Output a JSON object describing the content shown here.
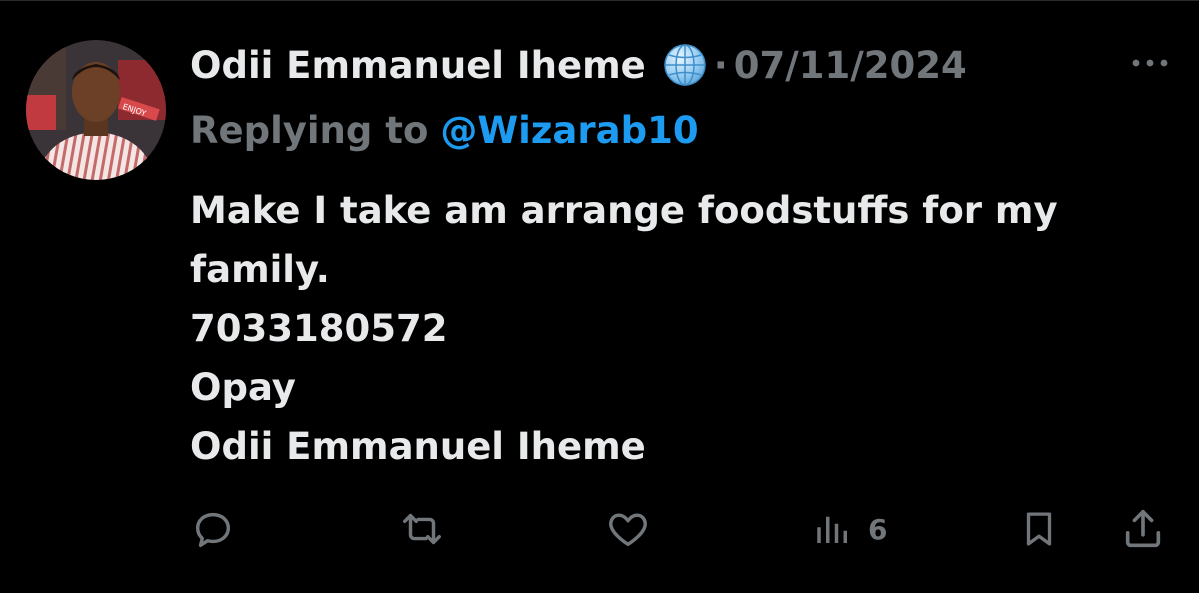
{
  "tweet": {
    "author_name": "Odii Emmanuel Iheme",
    "separator": "·",
    "date": "07/11/2024",
    "replying_prefix": "Replying to",
    "replying_handle": "@Wizarab10",
    "body_lines": [
      "Make I take am arrange foodstuffs for my",
      "family.",
      "7033180572",
      "Opay",
      "Odii Emmanuel Iheme"
    ],
    "avatar_sign_text": "ENJOY"
  },
  "actions": {
    "reply_icon": "reply-icon",
    "retweet_icon": "retweet-icon",
    "like_icon": "heart-icon",
    "views_icon": "views-chart-icon",
    "views_count": "6",
    "bookmark_icon": "bookmark-icon",
    "share_icon": "share-icon"
  },
  "colors": {
    "background": "#000000",
    "primary_text": "#e7e9ea",
    "secondary_text": "#71767b",
    "link": "#1d9bf0"
  }
}
